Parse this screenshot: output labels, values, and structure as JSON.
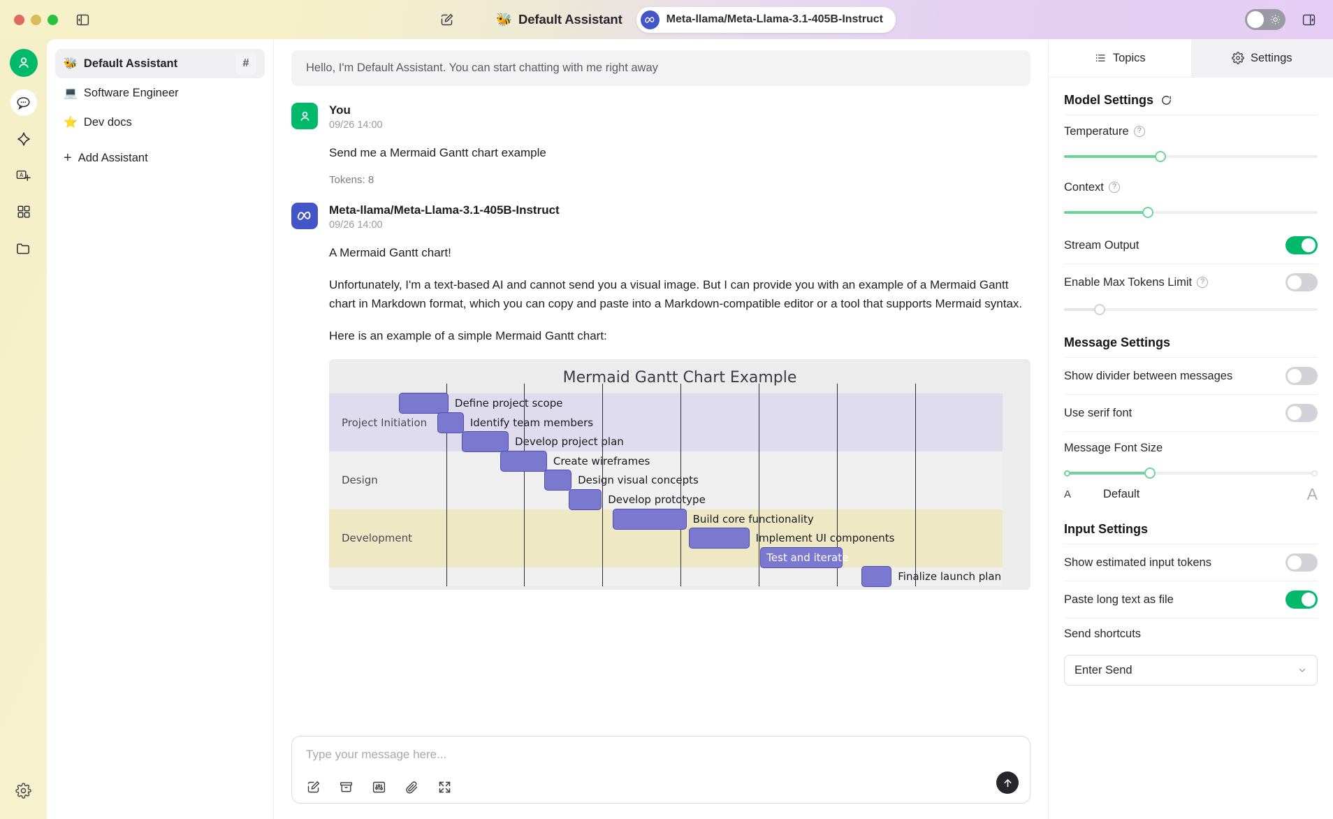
{
  "titlebar": {
    "window_controls": [
      "close",
      "minimize",
      "maximize"
    ],
    "left_sidebar_toggle_icon": "panel-left-icon",
    "new_chat_icon": "edit-square-icon",
    "assistant_emoji": "🐝",
    "assistant_name": "Default Assistant",
    "model_name": "Meta-llama/Meta-Llama-3.1-405B-Instruct",
    "model_badge_icon": "meta-logo-icon",
    "theme_toggle_icon": "sun-icon",
    "theme_toggle_state": "off",
    "right_sidebar_toggle_icon": "panel-right-icon"
  },
  "rail": {
    "items": [
      {
        "name": "user-avatar",
        "icon": "person-icon",
        "active": false
      },
      {
        "name": "chat",
        "icon": "chat-bubble-icon",
        "active": true
      },
      {
        "name": "agents",
        "icon": "sparkle-icon",
        "active": false
      },
      {
        "name": "translate",
        "icon": "translate-icon",
        "active": false
      },
      {
        "name": "apps",
        "icon": "grid-apps-icon",
        "active": false
      },
      {
        "name": "files",
        "icon": "folder-icon",
        "active": false
      }
    ],
    "bottom_item": {
      "name": "settings",
      "icon": "gear-icon"
    }
  },
  "assistants": {
    "items": [
      {
        "emoji": "🐝",
        "label": "Default Assistant",
        "active": true,
        "trailing_icon": "hash-icon"
      },
      {
        "emoji": "💻",
        "label": "Software Engineer",
        "active": false
      },
      {
        "emoji": "⭐",
        "label": "Dev docs",
        "active": false
      }
    ],
    "add_label": "Add Assistant",
    "add_icon": "plus-icon"
  },
  "chat": {
    "greeting": "Hello, I'm Default Assistant. You can start chatting with me right away",
    "messages": [
      {
        "role": "user",
        "name": "You",
        "avatar_icon": "person-icon",
        "time": "09/26 14:00",
        "paragraphs": [
          "Send me a Mermaid Gantt chart example"
        ],
        "tokens": "Tokens: 8"
      },
      {
        "role": "assistant",
        "name": "Meta-llama/Meta-Llama-3.1-405B-Instruct",
        "avatar_icon": "meta-logo-icon",
        "time": "09/26 14:00",
        "paragraphs": [
          "A Mermaid Gantt chart!",
          "Unfortunately, I'm a text-based AI and cannot send you a visual image. But I can provide you with an example of a Mermaid Gantt chart in Markdown format, which you can copy and paste into a Markdown-compatible editor or a tool that supports Mermaid syntax.",
          "Here is an example of a simple Mermaid Gantt chart:"
        ]
      }
    ]
  },
  "chart_data": {
    "type": "bar",
    "subtype": "gantt",
    "title": "Mermaid Gantt Chart Example",
    "xlabel": "",
    "ylabel": "",
    "grid": true,
    "gridline_count": 7,
    "sections": [
      {
        "name": "Project Initiation",
        "tasks": [
          {
            "label": "Define project scope",
            "start": 0.0,
            "duration": 0.09,
            "label_inside": false
          },
          {
            "label": "Identify team members",
            "start": 0.07,
            "duration": 0.048,
            "label_inside": false
          },
          {
            "label": "Develop project plan",
            "start": 0.115,
            "duration": 0.085,
            "label_inside": false
          }
        ]
      },
      {
        "name": "Design",
        "tasks": [
          {
            "label": "Create wireframes",
            "start": 0.185,
            "duration": 0.085,
            "label_inside": false
          },
          {
            "label": "Design visual concepts",
            "start": 0.265,
            "duration": 0.05,
            "label_inside": false
          },
          {
            "label": "Develop prototype",
            "start": 0.31,
            "duration": 0.06,
            "label_inside": false
          }
        ]
      },
      {
        "name": "Development",
        "tasks": [
          {
            "label": "Build core functionality",
            "start": 0.39,
            "duration": 0.135,
            "label_inside": false
          },
          {
            "label": "Implement UI components",
            "start": 0.53,
            "duration": 0.11,
            "label_inside": false
          },
          {
            "label": "Test and iterate",
            "start": 0.66,
            "duration": 0.15,
            "label_inside": true
          }
        ]
      },
      {
        "name": "",
        "tasks": [
          {
            "label": "Finalize launch plan",
            "start": 0.845,
            "duration": 0.055,
            "label_inside": false
          }
        ]
      }
    ]
  },
  "composer": {
    "placeholder": "Type your message here...",
    "tools": [
      {
        "name": "new-topic-icon",
        "glyph": "edit"
      },
      {
        "name": "knowledge-base-icon",
        "glyph": "archive"
      },
      {
        "name": "mcp-tools-icon",
        "glyph": "sliders"
      },
      {
        "name": "attachment-icon",
        "glyph": "paperclip"
      },
      {
        "name": "expand-icon",
        "glyph": "expand"
      }
    ],
    "send_icon": "arrow-up-icon"
  },
  "right_panel": {
    "tabs": [
      {
        "label": "Topics",
        "icon": "list-icon",
        "active": false
      },
      {
        "label": "Settings",
        "icon": "gear-icon",
        "active": true
      }
    ],
    "model_settings": {
      "heading": "Model Settings",
      "reset_icon": "refresh-icon",
      "temperature": {
        "label": "Temperature",
        "help_icon": "question-icon",
        "value_pct": 38
      },
      "context": {
        "label": "Context",
        "help_icon": "question-icon",
        "value_pct": 33
      },
      "stream_output": {
        "label": "Stream Output",
        "on": true
      },
      "max_tokens_limit": {
        "label": "Enable Max Tokens Limit",
        "help_icon": "question-icon",
        "on": false,
        "slider_pct": 14
      }
    },
    "message_settings": {
      "heading": "Message Settings",
      "rows": [
        {
          "label": "Show divider between messages",
          "on": false
        },
        {
          "label": "Use serif font",
          "on": false
        }
      ],
      "font_size": {
        "label": "Message Font Size",
        "value_pct": 34,
        "small_label": "A",
        "current_label": "Default",
        "large_label": "A"
      }
    },
    "input_settings": {
      "heading": "Input Settings",
      "rows": [
        {
          "label": "Show estimated input tokens",
          "on": false
        },
        {
          "label": "Paste long text as file",
          "on": true
        }
      ],
      "send_shortcuts": {
        "label": "Send shortcuts",
        "value": "Enter Send",
        "chevron_icon": "chevron-down-icon"
      }
    }
  }
}
